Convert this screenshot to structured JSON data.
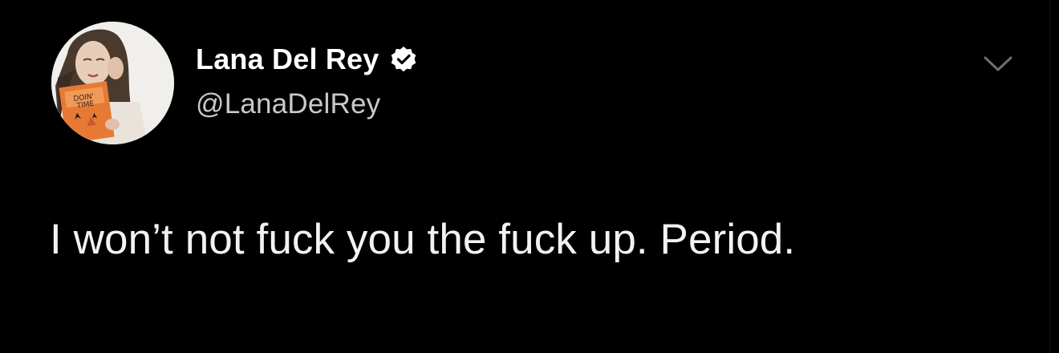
{
  "tweet": {
    "author": {
      "display_name": "Lana Del Rey",
      "handle": "@LanaDelRey",
      "verified": true,
      "avatar_book_text": [
        "DOIN'",
        "TIME"
      ]
    },
    "text": "I won’t not fuck you the fuck up. Period.",
    "menu_icon": "chevron-down-icon"
  },
  "colors": {
    "background": "#000000",
    "name": "#ffffff",
    "handle": "#c9c9cc",
    "text": "#f2f2f2",
    "verified_badge": "#ffffff",
    "chevron": "#6e6e73"
  }
}
